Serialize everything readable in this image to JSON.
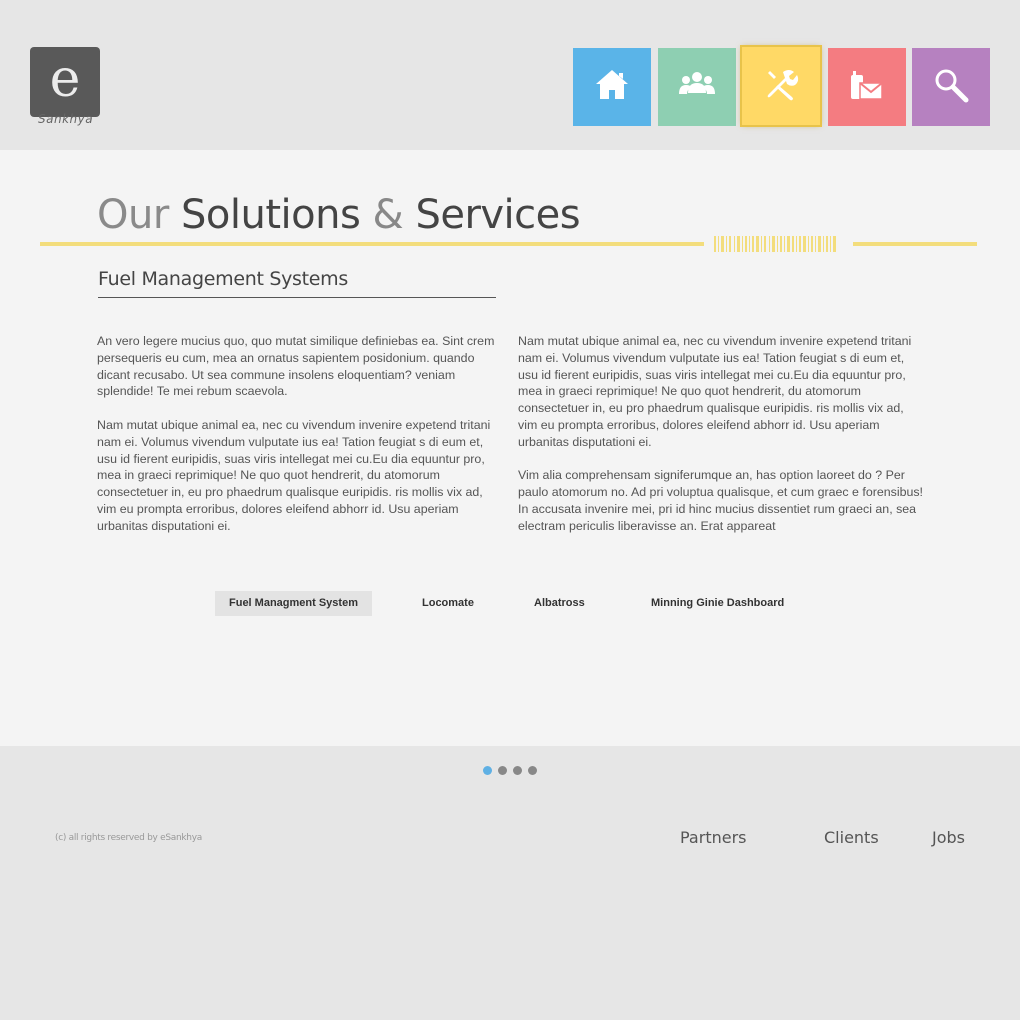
{
  "logo": {
    "letter": "e",
    "name": "Sankhya"
  },
  "nav": [
    {
      "name": "home",
      "icon": "home-icon",
      "color": "#5ab4e8"
    },
    {
      "name": "team",
      "icon": "users-icon",
      "color": "#8ecfb2"
    },
    {
      "name": "tools",
      "icon": "tools-icon",
      "color": "#ffd966"
    },
    {
      "name": "contact",
      "icon": "contact-icon",
      "color": "#f47c81"
    },
    {
      "name": "search",
      "icon": "search-icon",
      "color": "#b681c0"
    }
  ],
  "page": {
    "title_light": "Our",
    "title_part1": "Solutions",
    "title_amp": "&",
    "title_part2": "Services",
    "accent_color": "#f3dd7c"
  },
  "section": {
    "title": "Fuel Management Systems",
    "left_paragraphs": [
      "An vero legere mucius quo, quo mutat similique definiebas ea. Sint crem persequeris eu cum, mea an ornatus sapientem posidonium. quando dicant recusabo. Ut sea commune insolens eloquentiam? veniam splendide! Te mei rebum scaevola.",
      "Nam mutat ubique animal ea, nec cu vivendum invenire expetend tritani nam ei. Volumus vivendum vulputate ius ea! Tation feugiat s di eum et, usu id fierent euripidis, suas viris intellegat mei cu.Eu dia equuntur pro, mea in graeci reprimique! Ne quo quot hendrerit, du atomorum consectetuer in, eu pro phaedrum qualisque euripidis. ris mollis vix ad, vim eu prompta erroribus, dolores eleifend abhorr id. Usu aperiam urbanitas disputationi ei."
    ],
    "right_paragraphs": [
      "Nam mutat ubique animal ea, nec cu vivendum invenire expetend tritani nam ei. Volumus vivendum vulputate ius ea! Tation feugiat s di eum et, usu id fierent euripidis, suas viris intellegat mei cu.Eu dia equuntur pro, mea in graeci reprimique! Ne quo quot hendrerit, du atomorum consectetuer in, eu pro phaedrum qualisque euripidis. ris mollis vix ad, vim eu prompta erroribus, dolores eleifend abhorr id. Usu aperiam urbanitas disputationi ei.",
      "Vim alia comprehensam signiferumque an, has option laoreet do ? Per paulo atomorum no. Ad pri voluptua qualisque, et cum graec e forensibus! In accusata invenire mei, pri id hinc mucius dissentiet rum graeci an, sea electram periculis liberavisse an. Erat appareat"
    ]
  },
  "tabs": [
    {
      "label": "Fuel Managment System",
      "active": true
    },
    {
      "label": "Locomate",
      "active": false
    },
    {
      "label": "Albatross",
      "active": false
    },
    {
      "label": "Minning Ginie Dashboard",
      "active": false
    }
  ],
  "pagination": {
    "count": 4,
    "active_index": 0,
    "active_color": "#5fb0e4"
  },
  "footer": {
    "copyright": "(c) all rights reserved by eSankhya",
    "links": [
      "Partners",
      "Clients",
      "Jobs"
    ]
  }
}
